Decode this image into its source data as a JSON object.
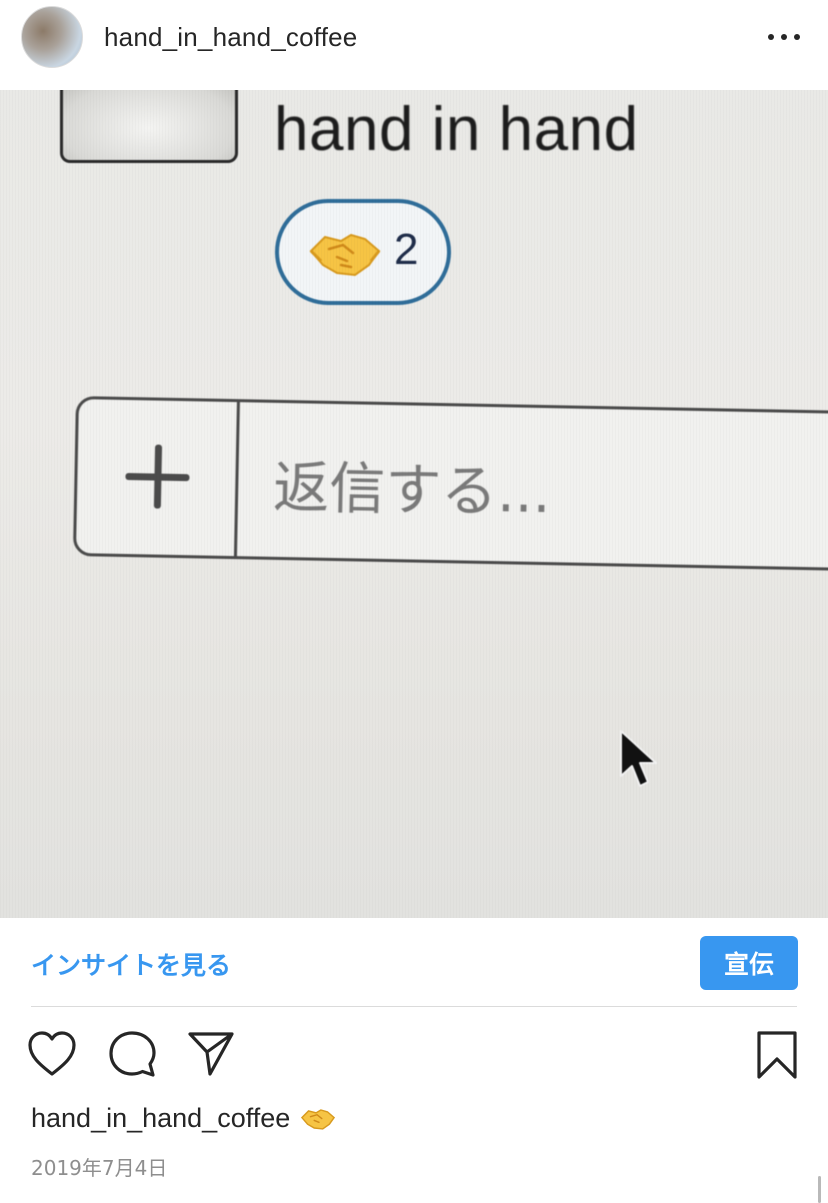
{
  "post": {
    "username": "hand_in_hand_coffee",
    "more_label": "•••"
  },
  "photo": {
    "title_text": "hand in hand",
    "reaction_emoji": "handshake-icon",
    "reaction_count": "2",
    "reply_placeholder": "返信する...",
    "reply_add_icon": "plus-icon"
  },
  "insights": {
    "link_label": "インサイトを見る",
    "promote_label": "宣伝"
  },
  "actions": {
    "icons": [
      "heart-icon",
      "comment-icon",
      "send-icon",
      "bookmark-icon"
    ]
  },
  "caption": {
    "username": "hand_in_hand_coffee",
    "emoji": "handshake-icon"
  },
  "meta": {
    "date": "2019年7月4日"
  },
  "colors": {
    "accent": "#3897f0",
    "text": "#262626",
    "muted": "#8e8e8e",
    "reaction_border": "#2f6d99"
  }
}
